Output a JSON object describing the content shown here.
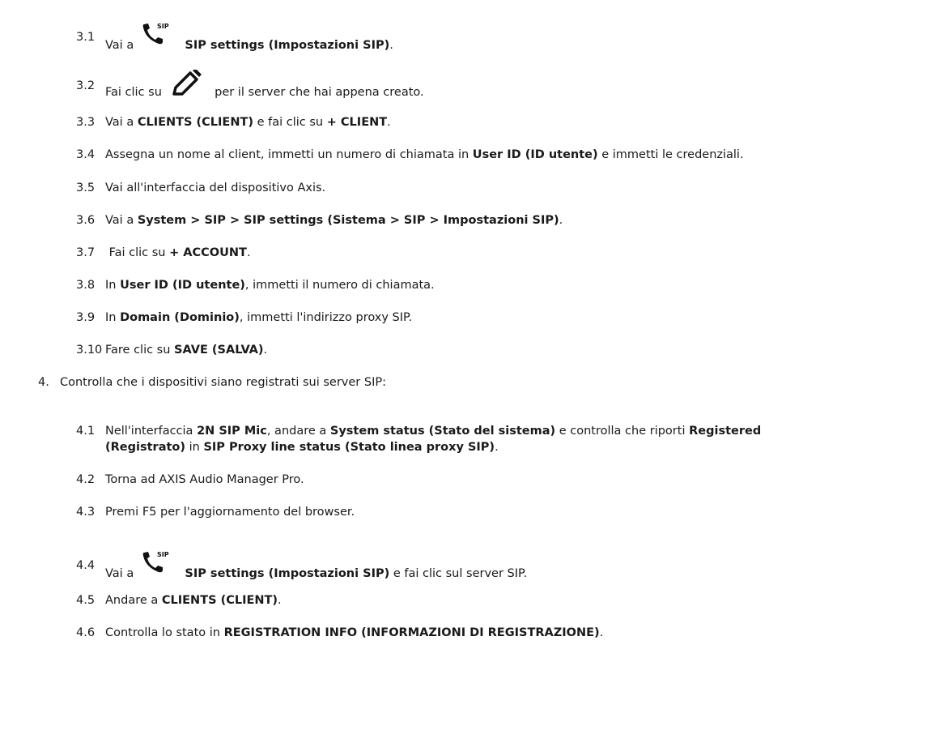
{
  "steps": {
    "s3_1": {
      "num": "3.1",
      "pre": "Vai a",
      "b1": "SIP settings (Impostazioni SIP)",
      "post": "."
    },
    "s3_2": {
      "num": "3.2",
      "pre": "Fai clic su",
      "post": "per il server che hai appena creato."
    },
    "s3_3": {
      "num": "3.3",
      "pre": "Vai a ",
      "b1": "CLIENTS (CLIENT)",
      "mid": " e fai clic su ",
      "b2": "+ CLIENT",
      "post": "."
    },
    "s3_4": {
      "num": "3.4",
      "pre": "Assegna un nome al client, immetti un numero di chiamata in ",
      "b1": "User ID (ID utente)",
      "post": " e immetti le credenziali."
    },
    "s3_5": {
      "num": "3.5",
      "pre": "Vai all'interfaccia del dispositivo Axis."
    },
    "s3_6": {
      "num": "3.6",
      "pre": "Vai a ",
      "b1": "System > SIP > SIP settings (Sistema > SIP > Impostazioni SIP)",
      "post": "."
    },
    "s3_7": {
      "num": "3.7",
      "pre": " Fai clic su ",
      "b1": "+ ACCOUNT",
      "post": "."
    },
    "s3_8": {
      "num": "3.8",
      "pre": "In ",
      "b1": "User ID (ID utente)",
      "post": ", immetti il numero di chiamata."
    },
    "s3_9": {
      "num": "3.9",
      "pre": "In ",
      "b1": "Domain (Dominio)",
      "post": ", immetti l'indirizzo proxy SIP."
    },
    "s3_10": {
      "num": "3.10",
      "pre": "Fare clic su ",
      "b1": "SAVE (SALVA)",
      "post": "."
    },
    "s4": {
      "num": "4.",
      "pre": "Controlla che i dispositivi siano registrati sui server SIP:"
    },
    "s4_1": {
      "num": "4.1",
      "pre": "Nell'interfaccia ",
      "b1": "2N SIP Mic",
      "mid": ", andare a ",
      "b2": "System status (Stato del sistema)",
      "mid2": " e controlla che riporti ",
      "b3": "Registered",
      "line2_b1": "(Registrato)",
      "line2_mid": " in ",
      "line2_b2": "SIP Proxy line status (Stato linea proxy SIP)",
      "line2_post": "."
    },
    "s4_2": {
      "num": "4.2",
      "pre": "Torna ad AXIS Audio Manager Pro."
    },
    "s4_3": {
      "num": "4.3",
      "pre": "Premi F5 per l'aggiornamento del browser."
    },
    "s4_4": {
      "num": "4.4",
      "pre": "Vai a",
      "b1": "SIP settings (Impostazioni SIP)",
      "post": " e fai clic sul server SIP."
    },
    "s4_5": {
      "num": "4.5",
      "pre": "Andare a ",
      "b1": "CLIENTS (CLIENT)",
      "post": "."
    },
    "s4_6": {
      "num": "4.6",
      "pre": "Controlla lo stato in ",
      "b1": "REGISTRATION INFO (INFORMAZIONI DI REGISTRAZIONE)",
      "post": "."
    }
  },
  "icons": {
    "sip_label": "SIP",
    "sip_icon": "phone-sip-icon",
    "edit_icon": "pencil-icon"
  }
}
